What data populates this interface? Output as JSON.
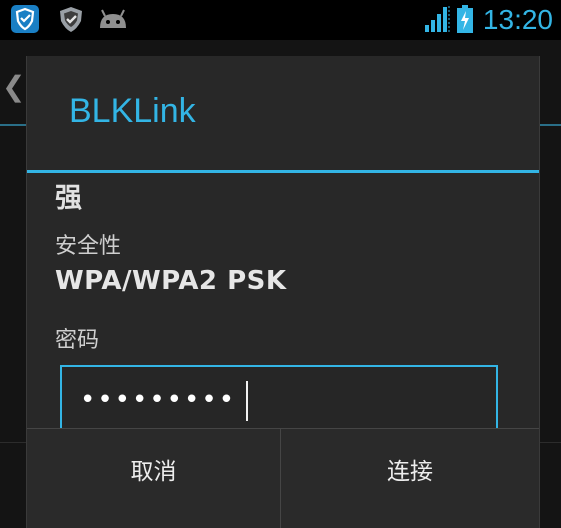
{
  "status_bar": {
    "time": "13:20",
    "icons": [
      "shield-app-icon",
      "shield-security-icon",
      "android-debug-icon",
      "signal-icon",
      "battery-charging-icon"
    ]
  },
  "dialog": {
    "title": "BLKLink",
    "signal_strength": "强",
    "security_label": "安全性",
    "security_value": "WPA/WPA2 PSK",
    "password_label": "密码",
    "password_value": "•••••••••",
    "cancel_label": "取消",
    "connect_label": "连接"
  },
  "colors": {
    "accent": "#33b5e5",
    "dialog_bg": "#282828",
    "text": "#e6e6e6"
  }
}
